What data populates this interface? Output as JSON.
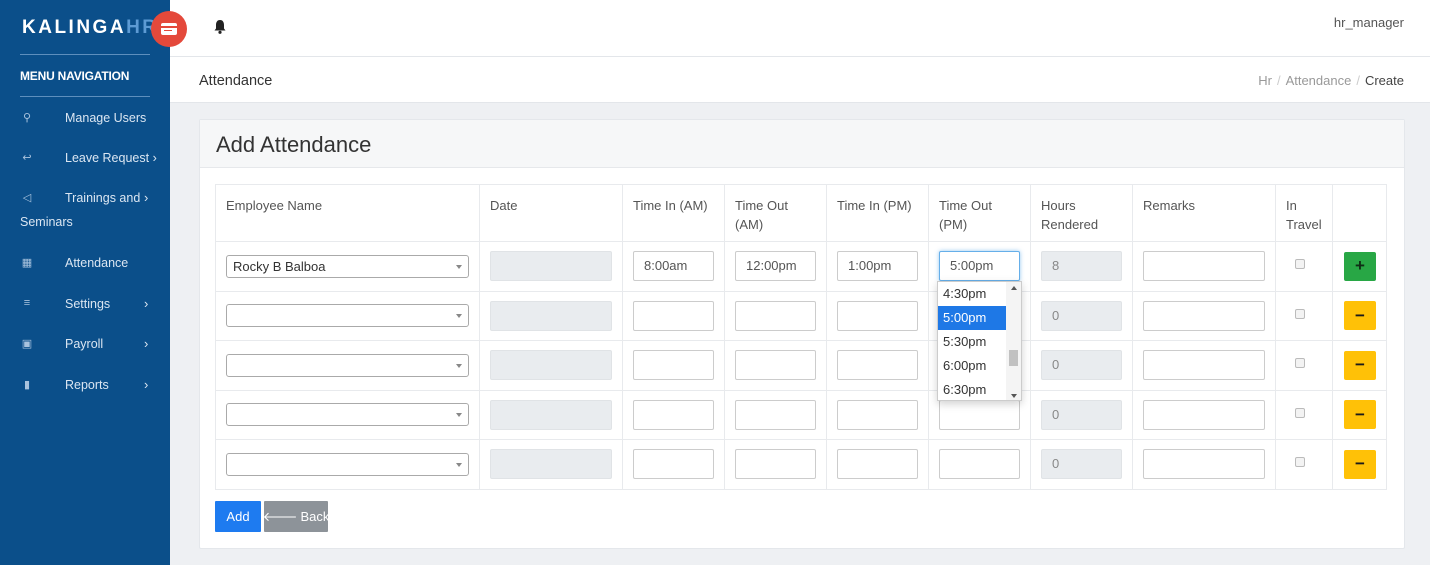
{
  "brand": {
    "name_main": "KALINGA",
    "name_accent": "HR"
  },
  "sidebar": {
    "menu_title": "MENU NAVIGATION",
    "items": [
      {
        "label": "Manage Users",
        "icon": "user-icon",
        "glyph": "⚲",
        "has_submenu": false
      },
      {
        "label": "Leave Request",
        "icon": "reply-icon",
        "glyph": "↩",
        "has_submenu": true,
        "chevron": "›"
      },
      {
        "label": "Trainings and",
        "label2": "Seminars",
        "icon": "bullhorn-icon",
        "glyph": "◁",
        "has_submenu": true,
        "chevron": "›"
      },
      {
        "label": "Attendance",
        "icon": "calendar-icon",
        "glyph": "▦",
        "has_submenu": false
      },
      {
        "label": "Settings",
        "icon": "list-icon",
        "glyph": "≡",
        "has_submenu": true,
        "chevron": "›"
      },
      {
        "label": "Payroll",
        "icon": "money-icon",
        "glyph": "▣",
        "has_submenu": true,
        "chevron": "›"
      },
      {
        "label": "Reports",
        "icon": "file-icon",
        "glyph": "▮",
        "has_submenu": true,
        "chevron": "›"
      }
    ]
  },
  "topbar": {
    "username": "hr_manager"
  },
  "page": {
    "title": "Attendance",
    "breadcrumb": [
      "Hr",
      "Attendance",
      "Create"
    ],
    "breadcrumb_sep": "/"
  },
  "form": {
    "title": "Add Attendance",
    "columns": [
      "Employee Name",
      "Date",
      "Time In (AM)",
      "Time Out (AM)",
      "Time In (PM)",
      "Time Out (PM)",
      "Hours Rendered",
      "Remarks",
      "In Travel",
      ""
    ],
    "rows": [
      {
        "employee": "Rocky B Balboa",
        "date": "",
        "time_in_am": "8:00am",
        "time_out_am": "12:00pm",
        "time_in_pm": "1:00pm",
        "time_out_pm": "5:00pm",
        "hours": "8",
        "remarks": "",
        "action": "+"
      },
      {
        "employee": "",
        "date": "",
        "time_in_am": "",
        "time_out_am": "",
        "time_in_pm": "",
        "time_out_pm": "",
        "hours": "0",
        "remarks": "",
        "action": "−"
      },
      {
        "employee": "",
        "date": "",
        "time_in_am": "",
        "time_out_am": "",
        "time_in_pm": "",
        "time_out_pm": "",
        "hours": "0",
        "remarks": "",
        "action": "−"
      },
      {
        "employee": "",
        "date": "",
        "time_in_am": "",
        "time_out_am": "",
        "time_in_pm": "",
        "time_out_pm": "",
        "hours": "0",
        "remarks": "",
        "action": "−"
      },
      {
        "employee": "",
        "date": "",
        "time_in_am": "",
        "time_out_am": "",
        "time_in_pm": "",
        "time_out_pm": "",
        "hours": "0",
        "remarks": "",
        "action": "−"
      }
    ],
    "time_dropdown": {
      "options": [
        "4:30pm",
        "5:00pm",
        "5:30pm",
        "6:00pm",
        "6:30pm"
      ],
      "selected": "5:00pm"
    },
    "buttons": {
      "add": "Add",
      "back": "Back",
      "back_icon": "🡐"
    }
  },
  "colors": {
    "sidebar_bg": "#0b4f8a",
    "primary": "#1e7bf0",
    "success": "#28a745",
    "warning": "#ffc107",
    "brand_badge": "#e4493b"
  }
}
